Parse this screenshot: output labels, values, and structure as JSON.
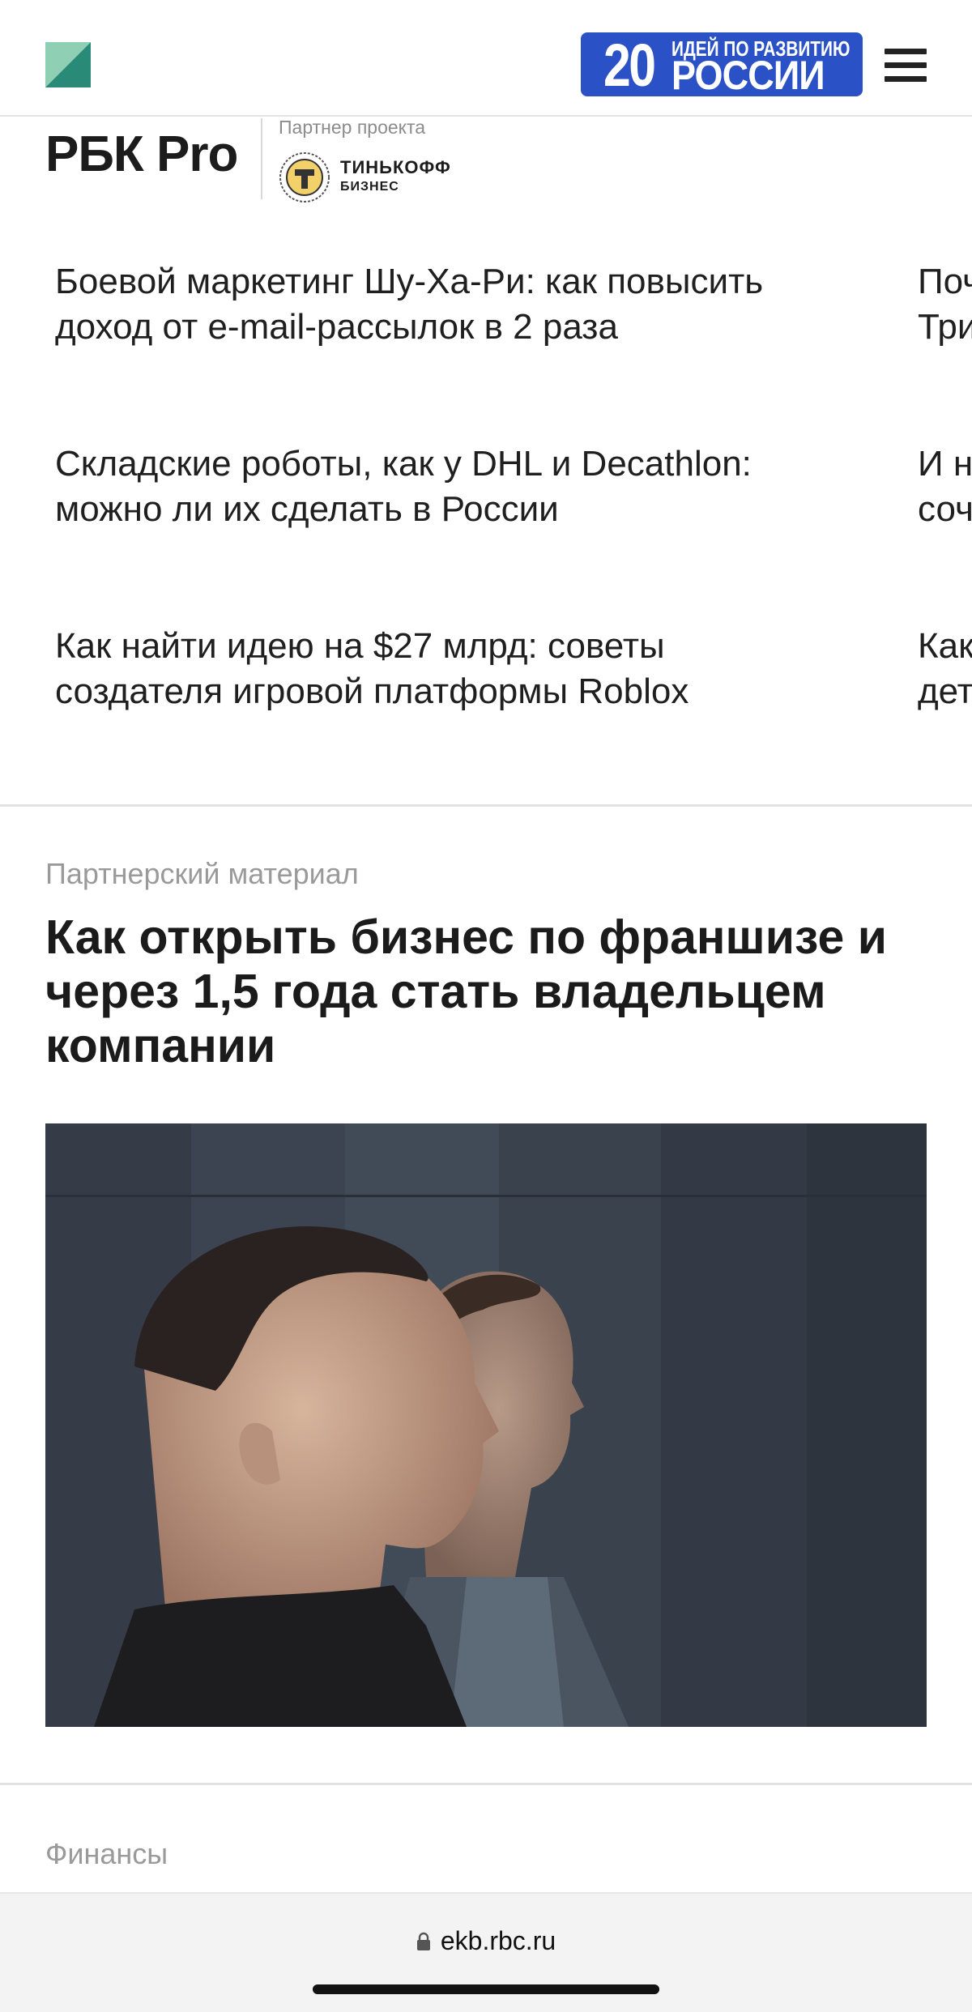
{
  "header": {
    "logo_icon": "rbc-logo-icon",
    "promo": {
      "number": "20",
      "line1": "ИДЕЙ ПО РАЗВИТИЮ",
      "line2": "РОССИИ",
      "color": "#2b51c7"
    },
    "menu_icon": "hamburger-icon"
  },
  "pro_block": {
    "title": "РБК Pro",
    "partner_label": "Партнер проекта",
    "partner_name": "ТИНЬКОФФ",
    "partner_sub": "БИЗНЕС"
  },
  "articles": [
    {
      "line1": "Боевой маркетинг Шу-Ха-Ри: как повысить",
      "line2": "доход от e-mail-рассылок в 2 раза",
      "peek1": "Поч",
      "peek2": "Три"
    },
    {
      "line1": "Складские роботы, как у DHL и Decathlon:",
      "line2": "можно ли их сделать в России",
      "peek1": "И н",
      "peek2": "соч"
    },
    {
      "line1": "Как найти идею на $27 млрд: советы",
      "line2": "создателя игровой платформы Roblox",
      "peek1": "Как",
      "peek2": "дет"
    }
  ],
  "feature": {
    "label": "Партнерский материал",
    "headline_line1": "Как открыть бизнес по франшизе и",
    "headline_line2": "через 1,5 года стать владельцем",
    "headline_line3": "компании",
    "photo": "photo-two-men-profile"
  },
  "next_section": {
    "category": "Финансы"
  },
  "browser": {
    "url": "ekb.rbc.ru",
    "lock_icon": "lock-icon"
  }
}
